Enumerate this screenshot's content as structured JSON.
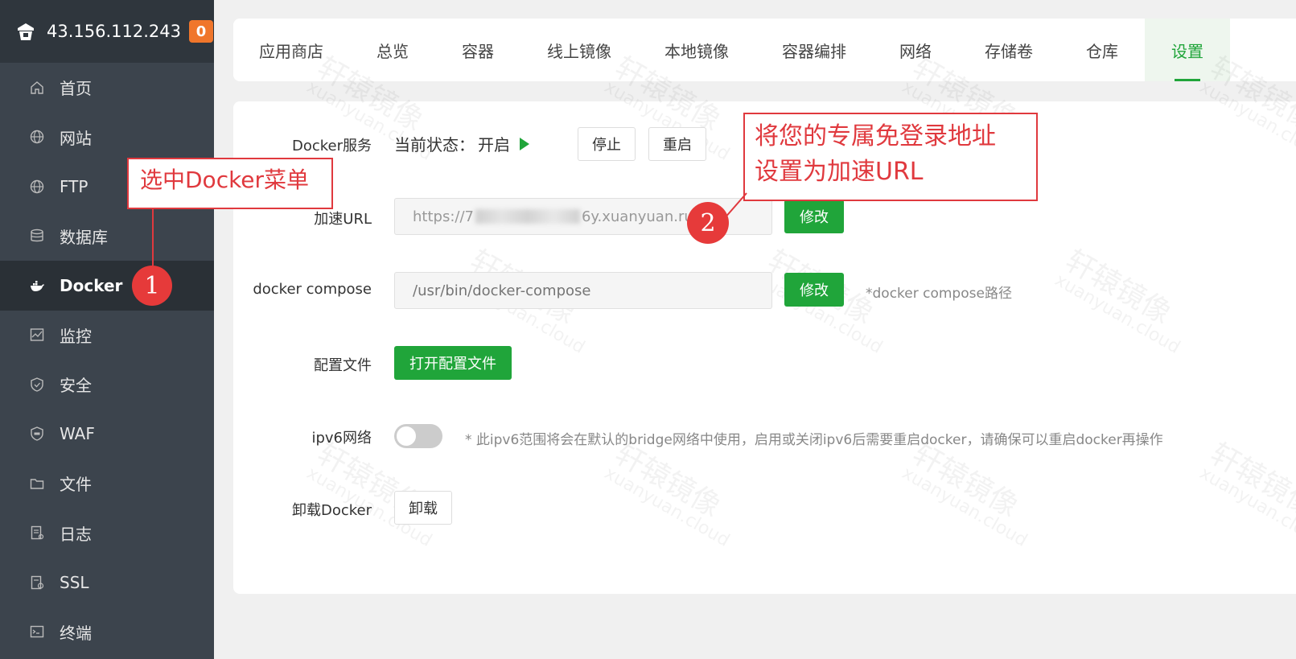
{
  "sidebar": {
    "server_ip": "43.156.112.243",
    "badge_count": "0",
    "items": [
      {
        "label": "首页",
        "icon": "home-icon"
      },
      {
        "label": "网站",
        "icon": "globe-icon"
      },
      {
        "label": "FTP",
        "icon": "globe-icon"
      },
      {
        "label": "数据库",
        "icon": "database-icon"
      },
      {
        "label": "Docker",
        "icon": "docker-icon",
        "active": true
      },
      {
        "label": "监控",
        "icon": "monitor-icon"
      },
      {
        "label": "安全",
        "icon": "shield-icon"
      },
      {
        "label": "WAF",
        "icon": "waf-shield-icon"
      },
      {
        "label": "文件",
        "icon": "folder-icon"
      },
      {
        "label": "日志",
        "icon": "log-icon"
      },
      {
        "label": "SSL",
        "icon": "certificate-icon"
      },
      {
        "label": "终端",
        "icon": "terminal-icon"
      }
    ]
  },
  "tabs": [
    "应用商店",
    "总览",
    "容器",
    "线上镜像",
    "本地镜像",
    "容器编排",
    "网络",
    "存储卷",
    "仓库",
    "设置"
  ],
  "active_tab": "设置",
  "settings": {
    "docker_service": {
      "label": "Docker服务",
      "status_prefix": "当前状态：",
      "status_value": "开启",
      "stop_label": "停止",
      "restart_label": "重启"
    },
    "mirror_url": {
      "label": "加速URL",
      "value_start": "https://7",
      "value_end": "6y.xuanyuan.run",
      "button": "修改"
    },
    "compose": {
      "label": "docker compose",
      "placeholder": "/usr/bin/docker-compose",
      "button": "修改",
      "hint": "*docker compose路径"
    },
    "config_file": {
      "label": "配置文件",
      "button": "打开配置文件"
    },
    "ipv6": {
      "label": "ipv6网络",
      "enabled": false,
      "hint": "* 此ipv6范围将会在默认的bridge网络中使用，启用或关闭ipv6后需要重启docker，请确保可以重启docker再操作"
    },
    "uninstall": {
      "label": "卸载Docker",
      "button": "卸载"
    }
  },
  "annotations": {
    "box1": "选中Docker菜单",
    "box2_line1": "将您的专属免登录地址",
    "box2_line2": "设置为加速URL",
    "num1": "1",
    "num2": "2"
  },
  "watermark": {
    "text": "轩辕镜像",
    "sub": "xuanyuan.cloud"
  },
  "colors": {
    "sidebar_bg": "#3c444d",
    "accent_green": "#20a53a",
    "badge_orange": "#f0762b",
    "annotation_red": "#e0393e"
  }
}
